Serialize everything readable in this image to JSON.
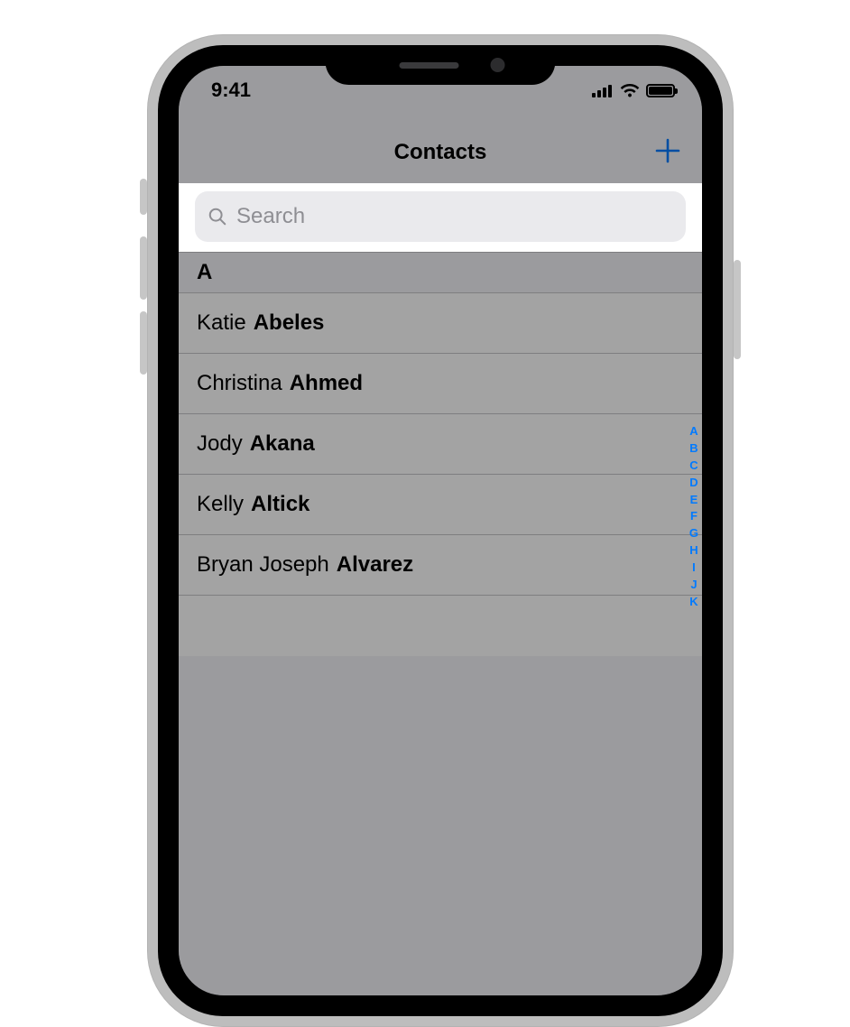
{
  "status": {
    "time": "9:41"
  },
  "nav": {
    "title": "Contacts"
  },
  "search": {
    "placeholder": "Search"
  },
  "section": {
    "letter": "A"
  },
  "contacts": [
    {
      "first": "Katie",
      "last": "Abeles"
    },
    {
      "first": "Christina",
      "last": "Ahmed"
    },
    {
      "first": "Jody",
      "last": "Akana"
    },
    {
      "first": "Kelly",
      "last": "Altick"
    },
    {
      "first": "Bryan Joseph",
      "last": "Alvarez"
    }
  ],
  "index_letters": [
    "A",
    "B",
    "C",
    "D",
    "E",
    "F",
    "G",
    "H",
    "I",
    "J",
    "K"
  ],
  "colors": {
    "accent": "#007aff"
  }
}
